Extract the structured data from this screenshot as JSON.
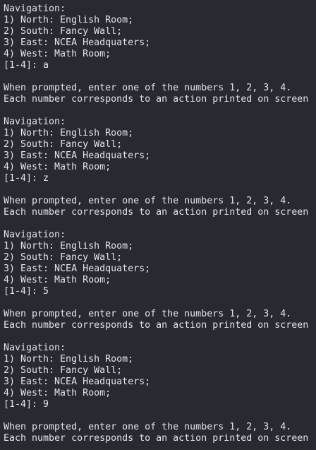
{
  "terminal": {
    "lines": [
      "Navigation:",
      "1) North: English Room;",
      "2) South: Fancy Wall;",
      "3) East: NCEA Headquaters;",
      "4) West: Math Room;",
      "[1-4]: a",
      "",
      "When prompted, enter one of the numbers 1, 2, 3, 4.",
      "Each number corresponds to an action printed on screen",
      "",
      "Navigation:",
      "1) North: English Room;",
      "2) South: Fancy Wall;",
      "3) East: NCEA Headquaters;",
      "4) West: Math Room;",
      "[1-4]: z",
      "",
      "When prompted, enter one of the numbers 1, 2, 3, 4.",
      "Each number corresponds to an action printed on screen",
      "",
      "Navigation:",
      "1) North: English Room;",
      "2) South: Fancy Wall;",
      "3) East: NCEA Headquaters;",
      "4) West: Math Room;",
      "[1-4]: 5",
      "",
      "When prompted, enter one of the numbers 1, 2, 3, 4.",
      "Each number corresponds to an action printed on screen",
      "",
      "Navigation:",
      "1) North: English Room;",
      "2) South: Fancy Wall;",
      "3) East: NCEA Headquaters;",
      "4) West: Math Room;",
      "[1-4]: 9",
      "",
      "When prompted, enter one of the numbers 1, 2, 3, 4.",
      "Each number corresponds to an action printed on screen"
    ]
  },
  "colors": {
    "background": "#272a31",
    "text": "#e2e4e8"
  }
}
